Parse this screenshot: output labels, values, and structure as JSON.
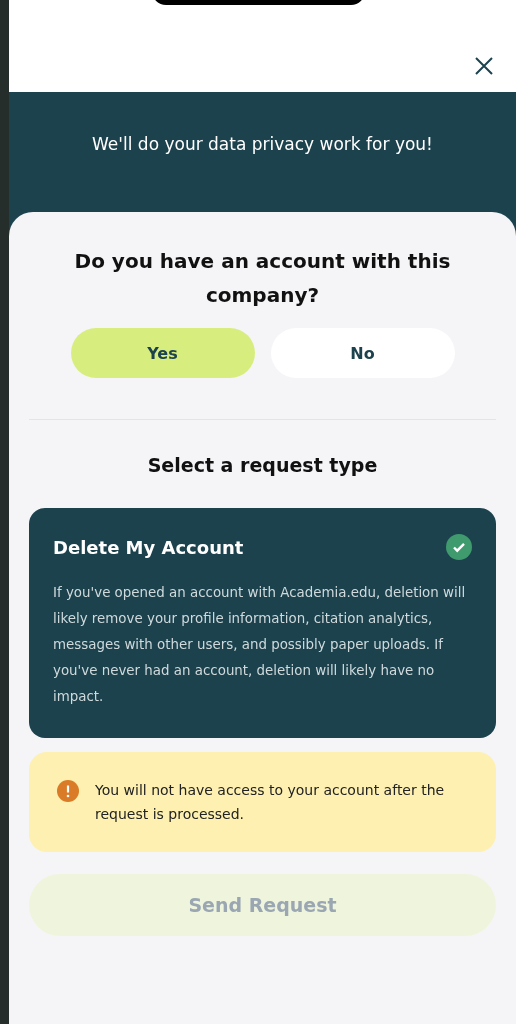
{
  "header": {
    "subtitle": "We'll do your data privacy work for you!"
  },
  "question": "Do you have an account with this company?",
  "options": [
    {
      "label": "Yes",
      "selected": true
    },
    {
      "label": "No",
      "selected": false
    }
  ],
  "section_title": "Select a request type",
  "request_types": [
    {
      "title": "Delete My Account",
      "description": "If you've opened an account with Academia.edu, deletion will likely remove your profile information, citation analytics, messages with other users, and possibly paper uploads. If you've never had an account, deletion will likely have no impact.",
      "selected": true
    }
  ],
  "warning": "You will not have access to your account after the request is processed.",
  "send_button": {
    "label": "Send Request",
    "disabled": true
  }
}
